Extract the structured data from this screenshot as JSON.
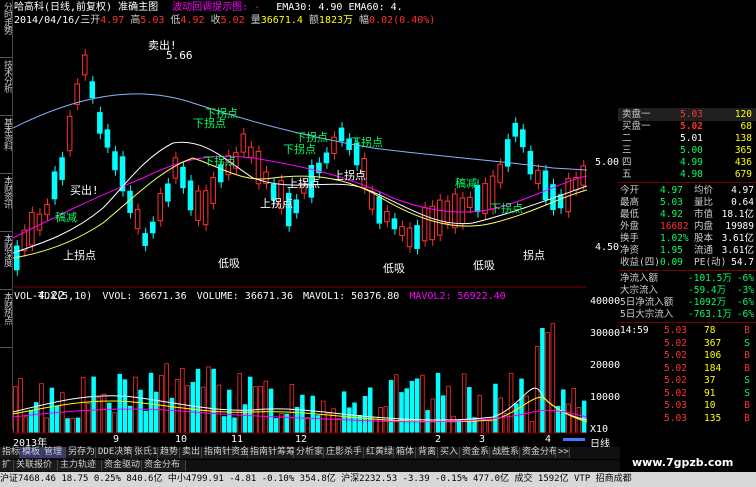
{
  "header": {
    "line1_stock": "哈高科(日线,前复权) 准确主图",
    "line1_alert": "波动回调提示图: -",
    "line1_ema": "EMA30: 4.90 EMA60: 4.",
    "line2_date": "2014/04/16/三",
    "line2_open_label": "开",
    "line2_open": "4.97",
    "line2_high_label": "高",
    "line2_high": "5.03",
    "line2_low_label": "低",
    "line2_low": "4.92",
    "line2_close_label": "收",
    "line2_close": "5.02",
    "line2_vol_label": "量",
    "line2_vol": "36671.4",
    "line2_amt_label": "额",
    "line2_amt": "1823万",
    "line2_chg_label": "幅",
    "line2_chg": "0.02(0.40%)"
  },
  "left_tabs": [
    "分时走势",
    "技术分析",
    "基本资料",
    "本财资讯",
    "本财深度",
    "本财热点"
  ],
  "annotations": [
    {
      "text": "卖出!",
      "color": "#ffffff"
    },
    {
      "text": "5.66",
      "color": "#ffffff"
    },
    {
      "text": "下拐点",
      "color": "#00ff66"
    },
    {
      "text": "下拐点",
      "color": "#00ff66"
    },
    {
      "text": "下拐点",
      "color": "#00ff66"
    },
    {
      "text": "下拐点",
      "color": "#00ff66"
    },
    {
      "text": "下拐点",
      "color": "#00ff66"
    },
    {
      "text": "下拐点",
      "color": "#00ff66"
    },
    {
      "text": "上拐点",
      "color": "#ffffff"
    },
    {
      "text": "上拐点",
      "color": "#ffffff"
    },
    {
      "text": "上拐点",
      "color": "#ffffff"
    },
    {
      "text": "上拐点",
      "color": "#ffffff"
    },
    {
      "text": "买出!",
      "color": "#ffffff"
    },
    {
      "text": "稿减",
      "color": "#00ff66"
    },
    {
      "text": "稿减",
      "color": "#00ff66"
    },
    {
      "text": "下拐点",
      "color": "#00ff66"
    },
    {
      "text": "4.22",
      "color": "#ffffff"
    },
    {
      "text": "低吸",
      "color": "#ffffff"
    },
    {
      "text": "低吸",
      "color": "#ffffff"
    },
    {
      "text": "低吸",
      "color": "#ffffff"
    },
    {
      "text": "拐点",
      "color": "#ffffff"
    }
  ],
  "price_axis": [
    "5.00",
    "4.50"
  ],
  "volume_header": {
    "name": "VOL-TDX(5,10)",
    "vvol": "VVOL: 36671.36",
    "volume": "VOLUME: 36671.36",
    "mavol1": "MAVOL1: 50376.80",
    "mavol2": "MAVOL2: 56922.40"
  },
  "volume_axis": [
    "40000",
    "30000",
    "20000",
    "10000",
    "X10"
  ],
  "time_axis": [
    "2013年",
    "9",
    "10",
    "11",
    "12",
    "2",
    "3",
    "4"
  ],
  "orderbook": {
    "sell": [
      {
        "label": "卖盘一",
        "price": "5.03",
        "vol": "120"
      },
      {
        "label": "买盘一",
        "price": "5.02",
        "vol": "68"
      },
      {
        "label": "二",
        "price": "5.01",
        "vol": "138"
      },
      {
        "label": "三",
        "price": "5.00",
        "vol": "365"
      },
      {
        "label": "四",
        "price": "4.99",
        "vol": "436"
      },
      {
        "label": "五",
        "price": "4.98",
        "vol": "679"
      }
    ]
  },
  "quote": [
    {
      "l1": "今开",
      "v1": "4.97",
      "l2": "均价",
      "v2": "4.97"
    },
    {
      "l1": "最高",
      "v1": "5.03",
      "l2": "量比",
      "v2": "0.64"
    },
    {
      "l1": "最低",
      "v1": "4.92",
      "l2": "市值",
      "v2": "18.1亿"
    },
    {
      "l1": "外盘",
      "v1": "16682",
      "l2": "内盘",
      "v2": "19989"
    },
    {
      "l1": "换手",
      "v1": "1.02%",
      "l2": "股本",
      "v2": "3.61亿"
    },
    {
      "l1": "净资",
      "v1": "1.95",
      "l2": "流通",
      "v2": "3.61亿"
    },
    {
      "l1": "收益(四)",
      "v1": "0.09",
      "l2": "PE(动)",
      "v2": "54.7"
    }
  ],
  "flows": [
    {
      "label": "净流入额",
      "value": "-101.5万",
      "pct": "-6%"
    },
    {
      "label": "大宗流入",
      "value": "-59.4万",
      "pct": "-3%"
    },
    {
      "label": "5日净流入额",
      "value": "-1092万",
      "pct": "-6%"
    },
    {
      "label": "5日大宗流入",
      "value": "-763.1万",
      "pct": "-6%"
    }
  ],
  "ticks": [
    {
      "time": "14:59",
      "price": "5.03",
      "vol": "78",
      "side": "B"
    },
    {
      "time": "",
      "price": "5.02",
      "vol": "367",
      "side": "S"
    },
    {
      "time": "",
      "price": "5.02",
      "vol": "106",
      "side": "B"
    },
    {
      "time": "",
      "price": "5.02",
      "vol": "184",
      "side": "B"
    },
    {
      "time": "",
      "price": "5.02",
      "vol": "37",
      "side": "S"
    },
    {
      "time": "",
      "price": "5.02",
      "vol": "91",
      "side": "S"
    },
    {
      "time": "",
      "price": "5.03",
      "vol": "10",
      "side": "B"
    },
    {
      "time": "",
      "price": "5.03",
      "vol": "135",
      "side": "B"
    }
  ],
  "bottom_tabs": [
    "指标",
    "模板",
    "管理",
    "另存为",
    "DDE决策",
    "张氏1",
    "趋势",
    "卖出",
    "指南针资金",
    "指南针筹筹",
    "分析家",
    "庄影杀手",
    "红黄绿",
    "箱体",
    "背离",
    "买入",
    "资金系",
    "战胜系",
    "资金分布",
    ">>"
  ],
  "bottom_tabs2": [
    "扩",
    "关联报价",
    "主力轨迹",
    "资金驱动",
    "资金分布"
  ],
  "right_label": "日线",
  "ticker": "沪证7468.46  18.75 0.25%  840.6亿  中小4799.91  -4.81 -0.10%  354.8亿  沪深2232.53  -3.39  -0.15%  477.0亿  成交  1592亿  VTP  招商成都",
  "watermark": "www.7gpzb.com",
  "colors": {
    "up": "#ff3030",
    "down": "#00ffff",
    "ma_white": "#ffffff",
    "ma_yellow": "#ffff00",
    "ma_magenta": "#ff00ff",
    "ma_blue": "#8ab4ff"
  }
}
